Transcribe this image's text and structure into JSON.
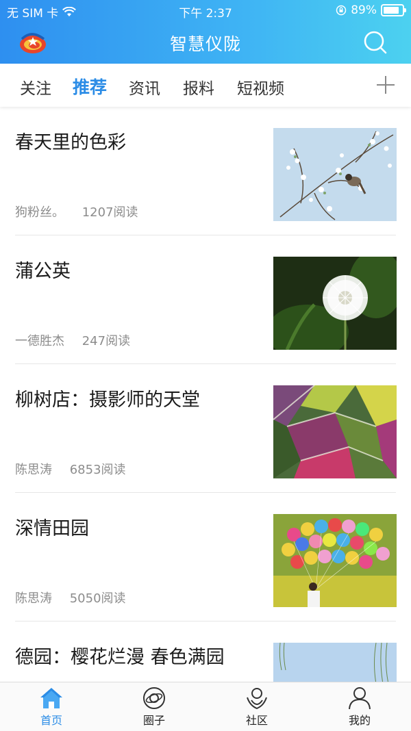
{
  "status_bar": {
    "carrier": "无 SIM 卡",
    "time": "下午 2:37",
    "battery": "89%"
  },
  "header": {
    "title": "智慧仪陇"
  },
  "tabs": [
    "关注",
    "推荐",
    "资讯",
    "报料",
    "短视频"
  ],
  "active_tab": "推荐",
  "feed": [
    {
      "title": "春天里的色彩",
      "author": "狗粉丝。",
      "reads": "1207阅读",
      "image": "bird-on-blossom-branch"
    },
    {
      "title": "蒲公英",
      "author": "一德胜杰",
      "reads": "247阅读",
      "image": "dandelion-seed-head"
    },
    {
      "title": "柳树店：摄影师的天堂",
      "author": "陈思涛",
      "reads": "6853阅读",
      "image": "aerial-flower-fields"
    },
    {
      "title": "深情田园",
      "author": "陈思涛",
      "reads": "5050阅读",
      "image": "balloons-in-rapeseed-field"
    },
    {
      "title": "德园：樱花烂漫  春色满园",
      "author": "",
      "reads": "",
      "image": "sky-and-willow"
    }
  ],
  "bottom_nav": [
    {
      "label": "首页",
      "icon": "home-icon"
    },
    {
      "label": "圈子",
      "icon": "planet-icon"
    },
    {
      "label": "社区",
      "icon": "community-icon"
    },
    {
      "label": "我的",
      "icon": "person-icon"
    }
  ],
  "colors": {
    "accent": "#2b8ce6",
    "header_start": "#2e8ff0",
    "header_end": "#4cd1f0"
  }
}
